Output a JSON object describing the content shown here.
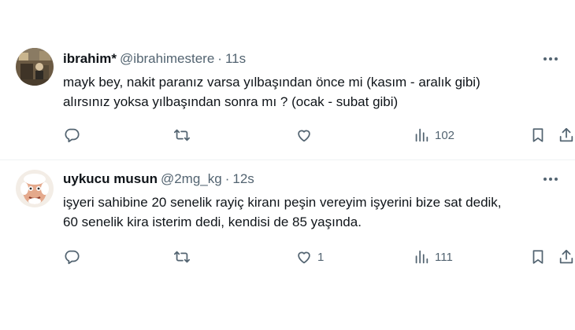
{
  "tweets": [
    {
      "name": "ibrahim*",
      "handle": "@ibrahimestere",
      "separator": "·",
      "time": "11s",
      "lines": [
        "mayk bey, nakit paranız varsa yılbaşından önce mi (kasım - aralık gibi)",
        "alırsınız yoksa yılbaşından sonra mı ? (ocak - subat gibi)"
      ],
      "replies": "",
      "retweets": "",
      "likes": "",
      "views": "102",
      "avatar_icon": "photo-avatar-icon"
    },
    {
      "name": "uykucu musun",
      "handle": "@2mg_kg",
      "separator": "·",
      "time": "12s",
      "lines": [
        "işyeri sahibine 20 senelik rayiç kiranı peşin vereyim işyerini bize sat dedik,",
        "60 senelik kira isterim dedi, kendisi de 85 yaşında."
      ],
      "replies": "",
      "retweets": "",
      "likes": "1",
      "views": "111",
      "avatar_icon": "cartoon-face-avatar-icon"
    }
  ],
  "colors": {
    "text_primary": "#0f1419",
    "text_secondary": "#536471",
    "divider": "#eff3f4",
    "background": "#ffffff"
  },
  "icons": [
    "reply-icon",
    "retweet-icon",
    "like-icon",
    "views-icon",
    "bookmark-icon",
    "share-icon",
    "more-icon"
  ]
}
